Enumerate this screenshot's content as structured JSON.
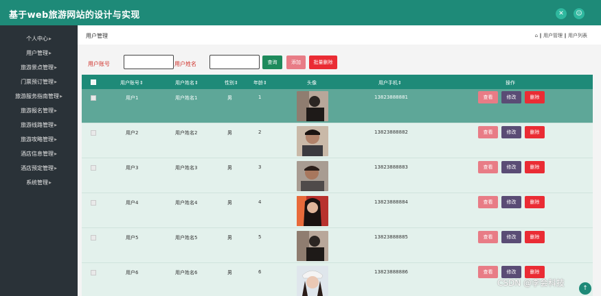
{
  "app": {
    "title": "基于web旅游网站的设计与实现",
    "icons": [
      "expand-icon",
      "user-icon"
    ],
    "theme_color": "#1e8a78",
    "sidebar_color": "#2a3238"
  },
  "sidebar": {
    "items": [
      {
        "label": "个人中心",
        "icon": "caret-icon"
      },
      {
        "label": "用户管理",
        "icon": "caret-icon"
      },
      {
        "label": "旅游景点管理",
        "icon": "caret-icon"
      },
      {
        "label": "门票预订管理",
        "icon": "caret-icon"
      },
      {
        "label": "旅游服务指南管理",
        "icon": "caret-icon"
      },
      {
        "label": "旅游报名管理",
        "icon": "caret-icon"
      },
      {
        "label": "旅游线路管理",
        "icon": "caret-icon"
      },
      {
        "label": "旅游攻略管理",
        "icon": "caret-icon"
      },
      {
        "label": "酒店信息管理",
        "icon": "caret-icon"
      },
      {
        "label": "酒店预定管理",
        "icon": "caret-icon"
      },
      {
        "label": "系统管理",
        "icon": "caret-icon"
      }
    ]
  },
  "page": {
    "title": "用户管理",
    "breadcrumb": "⌂ ‖ 用户管理 ‖ 用户列表"
  },
  "search": {
    "account_label": "用户账号",
    "account_value": "",
    "name_label": "用户姓名",
    "name_value": "",
    "search_button": "查询",
    "add_button": "添加",
    "batch_delete_button": "批量删除"
  },
  "table": {
    "headers": [
      "用户账号⇕",
      "用户姓名⇕",
      "性别⇕",
      "年龄⇕",
      "头像",
      "用户手机⇕",
      "操作"
    ],
    "action_labels": {
      "view": "查看",
      "edit": "修改",
      "delete": "删除"
    },
    "rows": [
      {
        "account": "用户1",
        "name": "用户姓名1",
        "gender": "男",
        "age": "1",
        "phone": "13823888881",
        "avatar": "avatar-1"
      },
      {
        "account": "用户2",
        "name": "用户姓名2",
        "gender": "男",
        "age": "2",
        "phone": "13823888882",
        "avatar": "avatar-2"
      },
      {
        "account": "用户3",
        "name": "用户姓名3",
        "gender": "男",
        "age": "3",
        "phone": "13823888883",
        "avatar": "avatar-3"
      },
      {
        "account": "用户4",
        "name": "用户姓名4",
        "gender": "男",
        "age": "4",
        "phone": "13823888884",
        "avatar": "avatar-4"
      },
      {
        "account": "用户5",
        "name": "用户姓名5",
        "gender": "男",
        "age": "5",
        "phone": "13823888885",
        "avatar": "avatar-5"
      },
      {
        "account": "用户6",
        "name": "用户姓名6",
        "gender": "男",
        "age": "6",
        "phone": "13823888886",
        "avatar": "avatar-6"
      }
    ]
  },
  "watermark": "CSDN @李会科技"
}
